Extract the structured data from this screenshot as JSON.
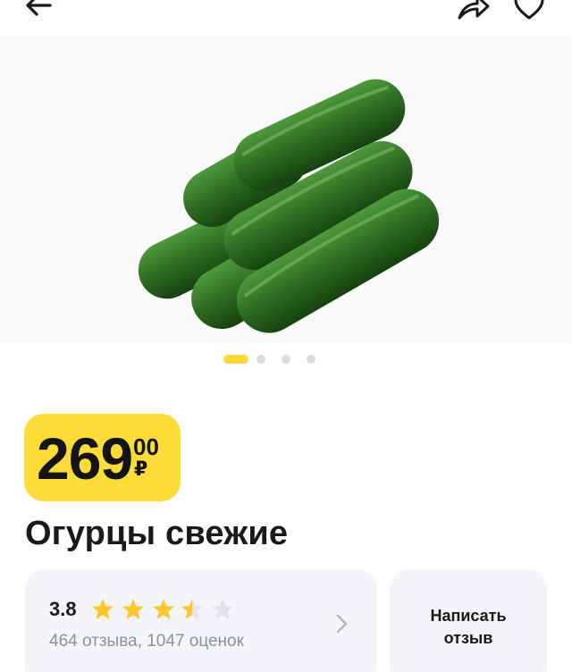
{
  "header": {
    "back_icon": "arrow-left-icon",
    "share_icon": "share-icon",
    "favorite_icon": "heart-icon"
  },
  "gallery": {
    "image_description": "cucumbers-photo",
    "slides_total": 4,
    "active_slide": 1
  },
  "price": {
    "main": "269",
    "cents": "00",
    "currency": "₽",
    "badge_color": "#fddc3a"
  },
  "product": {
    "title": "Огурцы свежие"
  },
  "rating": {
    "value": "3.8",
    "stars_filled": 3.5,
    "stars_total": 5,
    "summary": "464 отзыва, 1047 оценок",
    "star_color": "#fdc72c"
  },
  "actions": {
    "write_review": "Написать отзыв"
  }
}
